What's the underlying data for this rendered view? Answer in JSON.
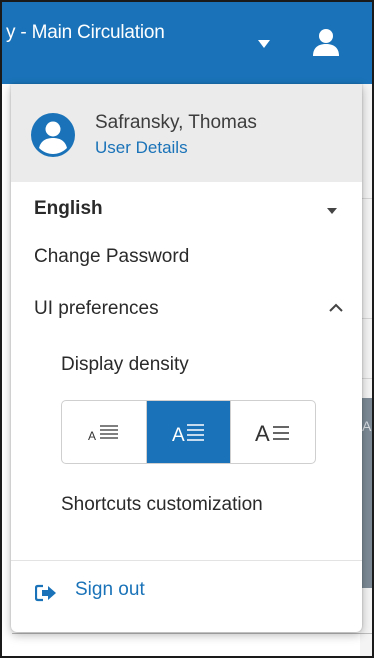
{
  "header": {
    "location_title": "y - Main Circulation",
    "location_dropdown_icon": "caret-down-icon",
    "user_menu_icon": "user-icon"
  },
  "user": {
    "name": "Safransky, Thomas",
    "details_link": "User Details",
    "avatar_icon": "user-circle-icon"
  },
  "menu": {
    "language": "English",
    "change_password": "Change Password",
    "ui_preferences": "UI preferences",
    "display_density": "Display density",
    "density_options": [
      "compact",
      "default",
      "comfortable"
    ],
    "density_selected": "default",
    "shortcuts": "Shortcuts customization",
    "sign_out": "Sign out"
  },
  "background": {
    "partial_text": "A"
  },
  "colors": {
    "brand_blue": "#1a73b8",
    "header_bg": "#1a73b8",
    "user_head_bg": "#ebebeb"
  }
}
